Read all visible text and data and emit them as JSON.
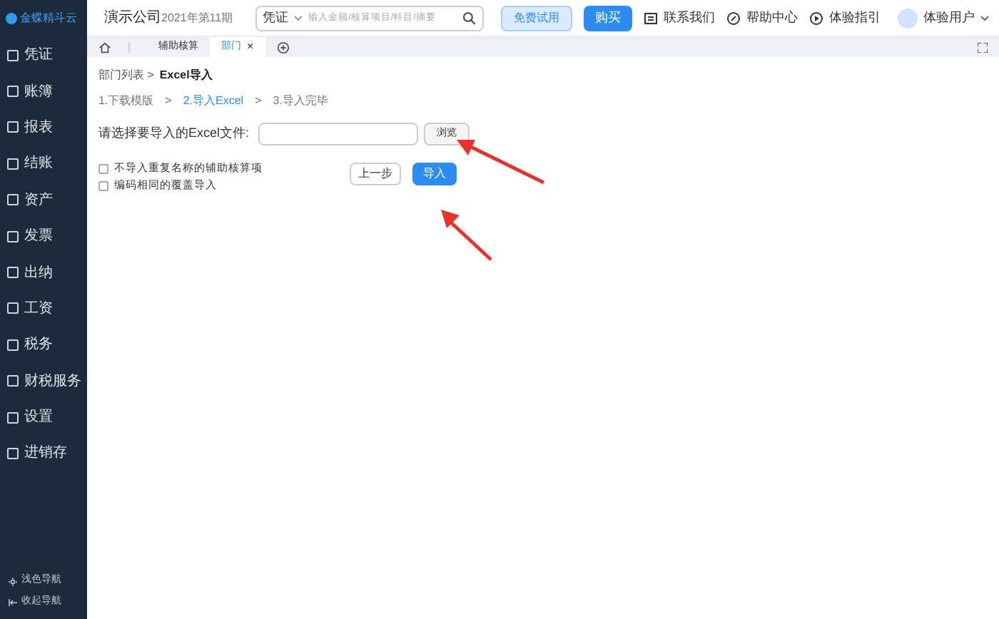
{
  "logo": "金蝶精斗云",
  "header": {
    "company": "演示公司",
    "period": "2021年第11期",
    "search_type": "凭证",
    "search_placeholder": "输入金额/核算项目/科目/摘要",
    "trial_button": "免费试用",
    "buy_button": "购买",
    "links": [
      {
        "label": "联系我们",
        "kind": "contact"
      },
      {
        "label": "帮助中心",
        "kind": "help"
      },
      {
        "label": "体验指引",
        "kind": "guide"
      }
    ],
    "user": "体验用户"
  },
  "sidebar": {
    "items": [
      {
        "label": "凭证"
      },
      {
        "label": "账簿"
      },
      {
        "label": "报表"
      },
      {
        "label": "结账"
      },
      {
        "label": "资产"
      },
      {
        "label": "发票"
      },
      {
        "label": "出纳"
      },
      {
        "label": "工资"
      },
      {
        "label": "税务"
      },
      {
        "label": "财税服务"
      },
      {
        "label": "设置"
      },
      {
        "label": "进销存"
      }
    ],
    "footer": [
      {
        "label": "浅色导航",
        "kind": "theme"
      },
      {
        "label": "收起导航",
        "kind": "collapse"
      }
    ]
  },
  "tabs": [
    {
      "label": "辅助核算",
      "selected": false
    },
    {
      "label": "部门",
      "selected": true,
      "close_label": "×"
    }
  ],
  "step_separators": [
    ">",
    ">"
  ],
  "breadcrumb": [
    "部门列表 >",
    "Excel导入"
  ],
  "steps": [
    {
      "label": "1.下载模版",
      "selected": false
    },
    {
      "label": "2.导入Excel",
      "selected": true
    },
    {
      "label": "3.导入完毕",
      "selected": false
    }
  ],
  "file_label": "请选择要导入的Excel文件:",
  "browse_button": "浏览",
  "options": [
    {
      "label": "不导入重复名称的辅助核算项",
      "checked": false
    },
    {
      "label": "编码相同的覆盖导入",
      "checked": false
    }
  ],
  "prev_button": "上一步",
  "import_button": "导入"
}
